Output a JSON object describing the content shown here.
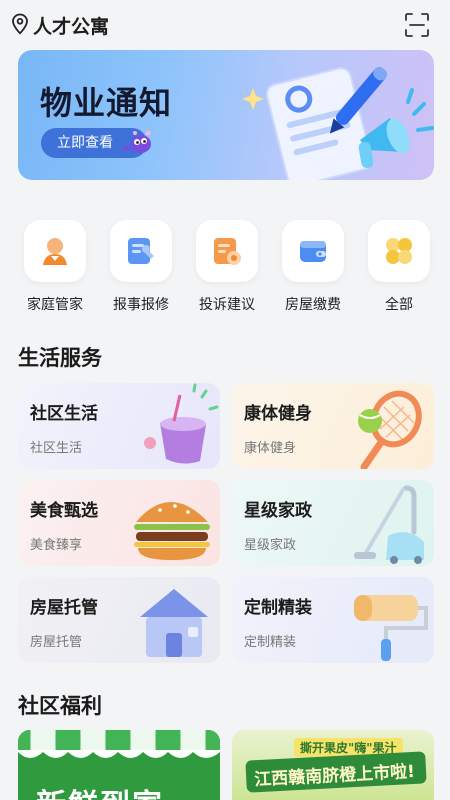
{
  "header": {
    "location": "人才公寓",
    "location_icon": "location-pin-icon",
    "scan_icon": "scan-icon"
  },
  "banner": {
    "title": "物业通知",
    "button_label": "立即查看"
  },
  "quick_menu": [
    {
      "label": "家庭管家",
      "icon": "housekeeper-icon"
    },
    {
      "label": "报事报修",
      "icon": "repair-report-icon"
    },
    {
      "label": "投诉建议",
      "icon": "complaint-icon"
    },
    {
      "label": "房屋缴费",
      "icon": "wallet-icon"
    },
    {
      "label": "全部",
      "icon": "grid-all-icon"
    }
  ],
  "life_services": {
    "title": "生活服务",
    "cards": [
      {
        "title": "社区生活",
        "subtitle": "社区生活"
      },
      {
        "title": "康体健身",
        "subtitle": "康体健身"
      },
      {
        "title": "美食甄选",
        "subtitle": "美食臻享"
      },
      {
        "title": "星级家政",
        "subtitle": "星级家政"
      },
      {
        "title": "房屋托管",
        "subtitle": "房屋托管"
      },
      {
        "title": "定制精装",
        "subtitle": "定制精装"
      }
    ]
  },
  "welfare": {
    "title": "社区福利",
    "cards": [
      {
        "text": "新鲜到家"
      },
      {
        "tagline": "撕开果皮\"嗨\"果汁",
        "headline": "江西赣南脐橙上市啦!"
      }
    ]
  },
  "colors": {
    "accent": "#3f72d8",
    "icon_orange": "#f28a2e",
    "icon_blue": "#4d8cf0",
    "icon_yellow": "#f5c53b",
    "welfare_green": "#2f9a3e"
  }
}
